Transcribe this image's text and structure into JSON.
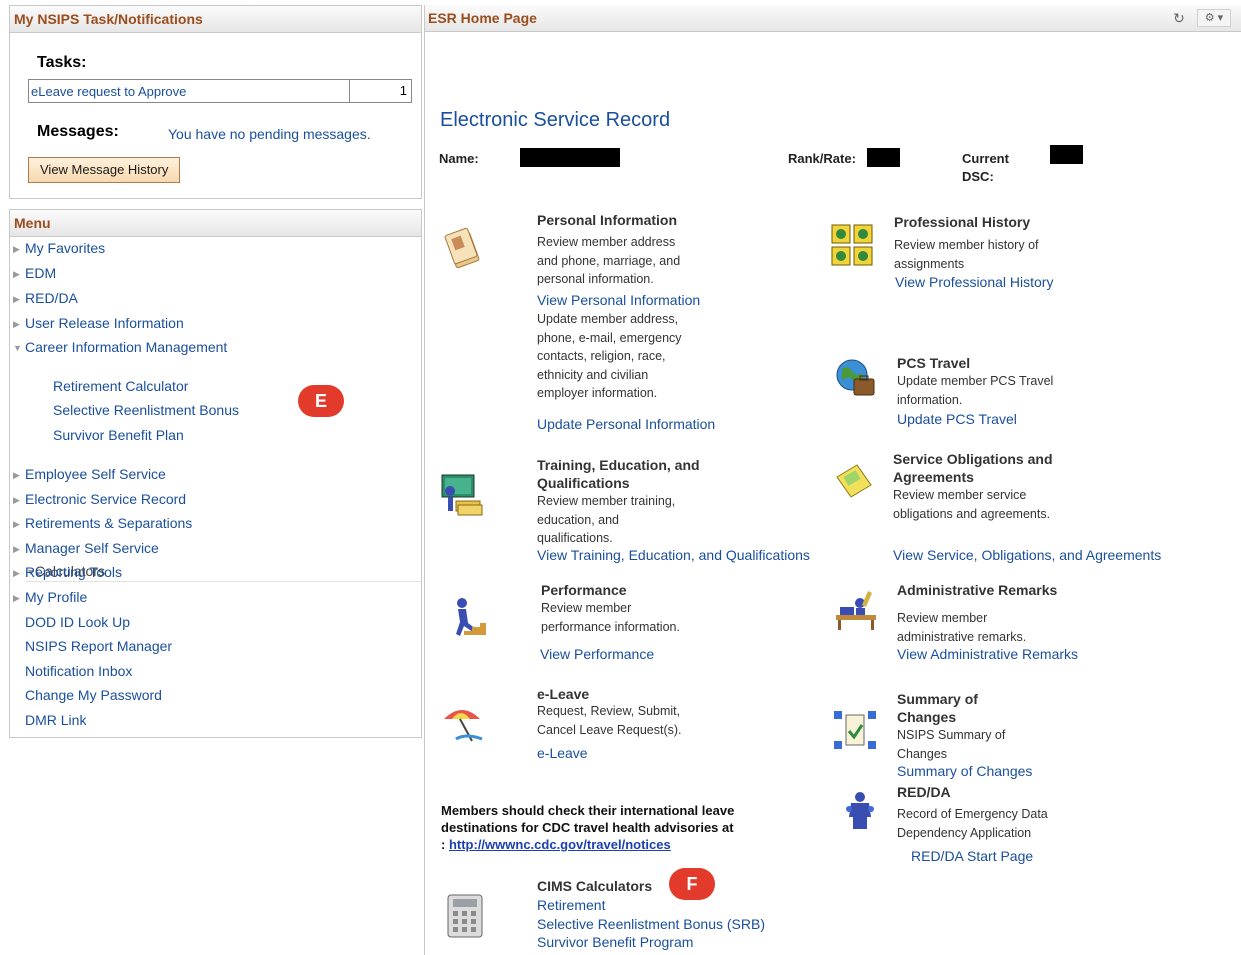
{
  "tasks_panel": {
    "title": "My NSIPS Task/Notifications",
    "tasks_label": "Tasks:",
    "task_name": "eLeave request to Approve",
    "task_count": "1",
    "messages_label": "Messages:",
    "messages_text": "You have no pending messages.",
    "history_button": "View Message History"
  },
  "menu": {
    "title": "Menu",
    "items_top": [
      "My Favorites",
      "EDM",
      "RED/DA",
      "User Release Information",
      "Career Information Management"
    ],
    "sub_heading": "Calculators",
    "sub_items": [
      "Retirement Calculator",
      "Selective Reenlistment Bonus",
      "Survivor Benefit Plan"
    ],
    "items_bottom": [
      "Employee Self Service",
      "Electronic Service Record",
      "Retirements & Separations",
      "Manager Self Service",
      "Reporting Tools",
      "My Profile",
      "DOD ID Look Up",
      "NSIPS Report Manager",
      "Notification Inbox",
      "Change My Password",
      "DMR Link"
    ]
  },
  "badges": {
    "e": "E",
    "f": "F"
  },
  "esr": {
    "panel_title": "ESR Home Page",
    "page_title": "Electronic Service Record",
    "name_label": "Name:",
    "rank_label": "Rank/Rate:",
    "dsc_label_1": "Current",
    "dsc_label_2": "DSC:",
    "personal": {
      "title": "Personal Information",
      "desc_lines": [
        "Review member address",
        "and phone, marriage, and",
        "personal information."
      ],
      "link_view": "View Personal Information",
      "update_lines": [
        "Update member address,",
        "phone, e-mail, emergency",
        "contacts, religion, race,",
        "ethnicity and civilian",
        "employer information."
      ],
      "link_update": "Update Personal Information"
    },
    "professional": {
      "title": "Professional History",
      "desc_lines": [
        "Review member history of",
        "assignments"
      ],
      "link": "View Professional History"
    },
    "pcs": {
      "title": "PCS Travel",
      "desc_lines": [
        "Update member PCS Travel",
        "information."
      ],
      "link": "Update PCS Travel"
    },
    "training": {
      "title_lines": [
        "Training, Education, and",
        "Qualifications"
      ],
      "desc_lines": [
        "Review member training,",
        "education, and",
        "qualifications."
      ],
      "link": "View Training, Education, and Qualifications"
    },
    "obligations": {
      "title_lines": [
        "Service Obligations and",
        "Agreements"
      ],
      "desc_lines": [
        "Review member service",
        "obligations and agreements."
      ],
      "link": "View Service, Obligations, and Agreements"
    },
    "performance": {
      "title": "Performance",
      "desc_lines": [
        "Review member",
        "performance information."
      ],
      "link": "View Performance"
    },
    "admin": {
      "title": "Administrative Remarks",
      "desc_lines": [
        "Review member",
        "administrative remarks."
      ],
      "link": "View Administrative Remarks"
    },
    "eleave": {
      "title": "e-Leave",
      "desc_lines": [
        "Request, Review, Submit,",
        "Cancel Leave Request(s)."
      ],
      "link": "e-Leave"
    },
    "summary": {
      "title_lines": [
        "Summary of",
        "Changes"
      ],
      "desc_lines": [
        "NSIPS Summary of",
        "Changes"
      ],
      "link": "Summary of Changes"
    },
    "redda": {
      "title": "RED/DA",
      "desc_lines": [
        "Record of Emergency Data",
        "Dependency Application"
      ],
      "link": "RED/DA Start Page"
    },
    "cdc": {
      "line1": "Members should check their international leave",
      "line2": "destinations for CDC travel health advisories at",
      "prefix": ": ",
      "url": "http://wwwnc.cdc.gov/travel/notices"
    },
    "cims": {
      "title": "CIMS Calculators",
      "links": [
        "Retirement",
        "Selective Reenlistment Bonus (SRB)",
        "Survivor Benefit Program"
      ]
    }
  },
  "colors": {
    "panel_title": "#9b4d1e",
    "link": "#1a4f9c",
    "badge": "#e23a2b"
  }
}
